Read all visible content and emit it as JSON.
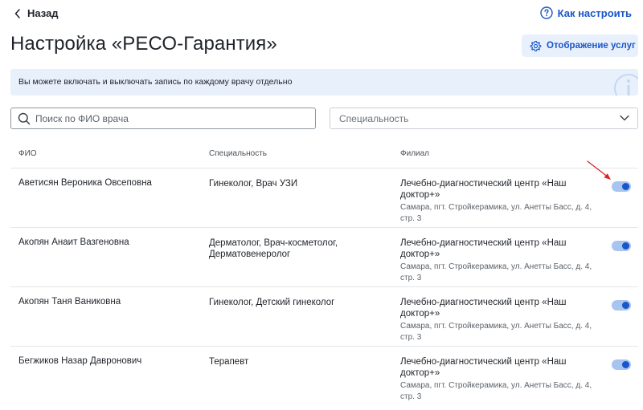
{
  "header": {
    "back_label": "Назад",
    "help_label": "Как настроить"
  },
  "page": {
    "title": "Настройка «РЕСО-Гарантия»",
    "display_button_label": "Отображение услуг",
    "info_text": "Вы можете включать и выключать запись по каждому врачу отдельно"
  },
  "filters": {
    "search_placeholder": "Поиск по ФИО врача",
    "specialty_label": "Специальность"
  },
  "table": {
    "columns": [
      "ФИО",
      "Специальность",
      "Филиал"
    ],
    "rows": [
      {
        "name": "Аветисян Вероника Овсеповна",
        "specialty": "Гинеколог, Врач УЗИ",
        "branch": "Лечебно-диагностический центр «Наш доктор+»",
        "address": "Самара, пгт. Стройкерамика, ул. Анетты Басс, д. 4, стр. 3",
        "enabled": true
      },
      {
        "name": "Акопян Анаит Вазгеновна",
        "specialty": "Дерматолог, Врач-косметолог, Дерматовенеролог",
        "branch": "Лечебно-диагностический центр «Наш доктор+»",
        "address": "Самара, пгт. Стройкерамика, ул. Анетты Басс, д. 4, стр. 3",
        "enabled": true
      },
      {
        "name": "Акопян Таня Ваниковна",
        "specialty": "Гинеколог, Детский гинеколог",
        "branch": "Лечебно-диагностический центр «Наш доктор+»",
        "address": "Самара, пгт. Стройкерамика, ул. Анетты Басс, д. 4, стр. 3",
        "enabled": true
      },
      {
        "name": "Бегжиков Назар Давронович",
        "specialty": "Терапевт",
        "branch": "Лечебно-диагностический центр «Наш доктор+»",
        "address": "Самара, пгт. Стройкерамика, ул. Анетты Басс, д. 4, стр. 3",
        "enabled": true
      }
    ]
  },
  "icons": {
    "back": "chevron-left-icon",
    "help": "question-circle-icon",
    "settings": "gear-icon",
    "info": "info-icon",
    "search": "search-icon",
    "dropdown": "chevron-down-icon",
    "annotation": "red-arrow-icon"
  },
  "colors": {
    "accent": "#1a56c9",
    "accent_light": "#e8f0fc",
    "toggle_track": "#a8c4f0",
    "annotation_arrow": "#e02020"
  }
}
